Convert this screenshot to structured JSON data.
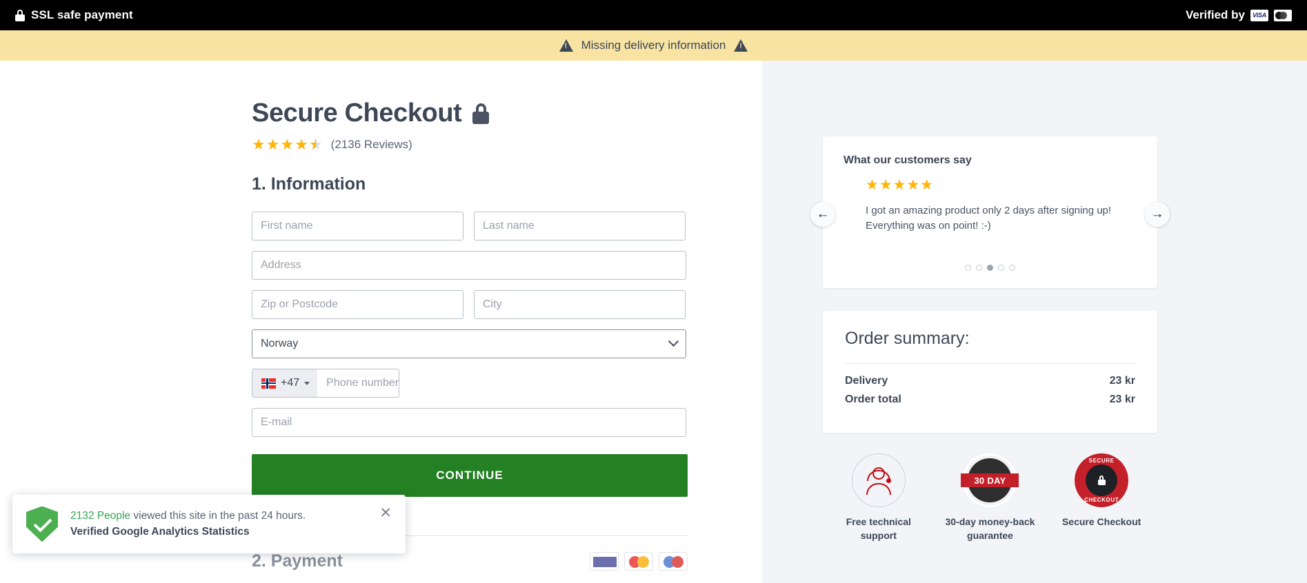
{
  "topbar": {
    "ssl_label": "SSL safe payment",
    "lock_icon": "lock-icon",
    "verified_label": "Verified by",
    "visa_label": "VISA",
    "card_icons": [
      "visa-logo-icon",
      "mastercard-logo-icon"
    ]
  },
  "warning": {
    "message": "Missing delivery information",
    "icon": "warning-triangle-icon"
  },
  "checkout": {
    "title": "Secure Checkout",
    "lock_icon": "lock-icon",
    "rating_value": 4.5,
    "stars_full": 4,
    "stars_half": 1,
    "reviews_label": "(2136 Reviews)",
    "step1_title": "1. Information",
    "fields": {
      "first_name_placeholder": "First name",
      "last_name_placeholder": "Last name",
      "address_placeholder": "Address",
      "zip_placeholder": "Zip or Postcode",
      "city_placeholder": "City",
      "country_selected": "Norway",
      "country_options": [
        "Norway"
      ],
      "phone_prefix": "+47",
      "phone_flag": "norway-flag-icon",
      "phone_placeholder": "Phone number",
      "email_placeholder": "E-mail"
    },
    "continue_label": "CONTINUE",
    "step2_title": "2. Payment",
    "payment_logos": [
      "visa-card-icon",
      "mastercard-card-icon",
      "maestro-card-icon"
    ]
  },
  "testimonial": {
    "heading": "What our customers say",
    "stars": "★★★★★",
    "quote": "I got an amazing product only 2 days after signing up! Everything was on point! :-)",
    "prev_icon": "arrow-left-icon",
    "next_icon": "arrow-right-icon",
    "prev_label": "←",
    "next_label": "→",
    "dots_total": 5,
    "dot_active_index": 2
  },
  "order_summary": {
    "title": "Order summary:",
    "rows": [
      {
        "label": "Delivery",
        "value": "23 kr"
      },
      {
        "label": "Order total",
        "value": "23 kr"
      }
    ]
  },
  "trust_badges": [
    {
      "label": "Free technical support",
      "icon": "headset-support-icon"
    },
    {
      "label": "30-day money-back guarantee",
      "icon": "money-back-seal-icon",
      "seal_text": "30 DAY"
    },
    {
      "label": "Secure Checkout",
      "icon": "secure-checkout-seal-icon",
      "seal_top": "SECURE",
      "seal_bottom": "CHECKOUT"
    }
  ],
  "social_proof": {
    "count_text": "2132 People",
    "rest_text": " viewed this site in the past 24 hours.",
    "verified_text": "Verified Google Analytics Statistics",
    "close_label": "✕",
    "shield_icon": "green-shield-check-icon"
  },
  "colors": {
    "accent_green": "#238023",
    "warning_bg": "#f8e3a3",
    "star_gold": "#ffb406",
    "text_dark": "#3d4756",
    "sidebar_bg": "#f2f4f7",
    "badge_red": "#c4202a",
    "proof_green": "#4caf50"
  }
}
